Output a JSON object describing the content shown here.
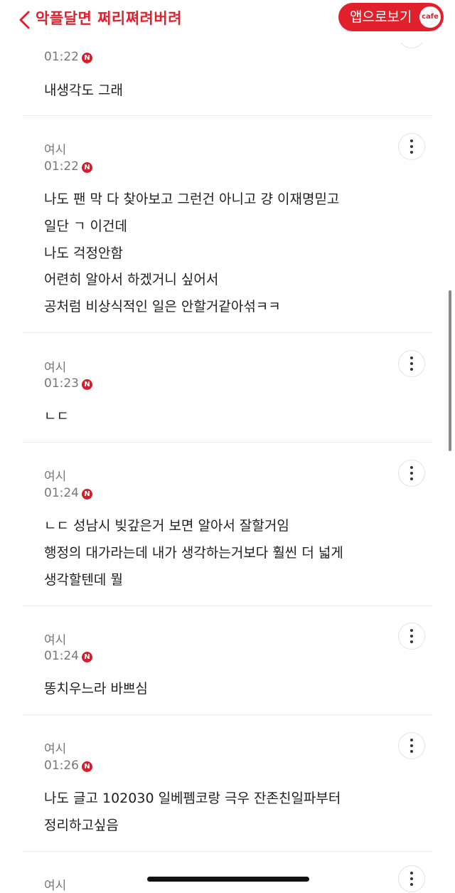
{
  "header": {
    "back_icon": "chevron-left-icon",
    "title": "악플달면 쩌리쪄려버려",
    "app_button_label": "앱으로보기",
    "cafe_badge": "cafe",
    "accent_color": "#e2202b"
  },
  "badge_letter": "N",
  "comments": [
    {
      "author": "",
      "time": "01:22",
      "lines": [
        "내생각도 그래"
      ]
    },
    {
      "author": "여시",
      "time": "01:22",
      "lines": [
        "나도 팬 막 다 찾아보고 그런건 아니고 걍 이재명믿고",
        "일단 ㄱ 이건데",
        "나도 걱정안함",
        "어련히 알아서 하겠거니 싶어서",
        "공처럼 비상식적인 일은 안할거같아섞ㅋㅋ"
      ]
    },
    {
      "author": "여시",
      "time": "01:23",
      "lines": [
        "ㄴㄷ"
      ]
    },
    {
      "author": "여시",
      "time": "01:24",
      "lines": [
        "ㄴㄷ 성남시 빚갚은거 보면 알아서 잘할거임",
        "행정의 대가라는데 내가 생각하는거보다 훨씬 더 넓게",
        "생각할텐데 뭘"
      ]
    },
    {
      "author": "여시",
      "time": "01:24",
      "lines": [
        "똥치우느라 바쁘심"
      ]
    },
    {
      "author": "여시",
      "time": "01:26",
      "lines": [
        "나도 글고 102030 일베펨코랑 극우 잔존친일파부터",
        "정리하고싶음"
      ]
    },
    {
      "author": "여시",
      "time": "",
      "lines": []
    }
  ]
}
